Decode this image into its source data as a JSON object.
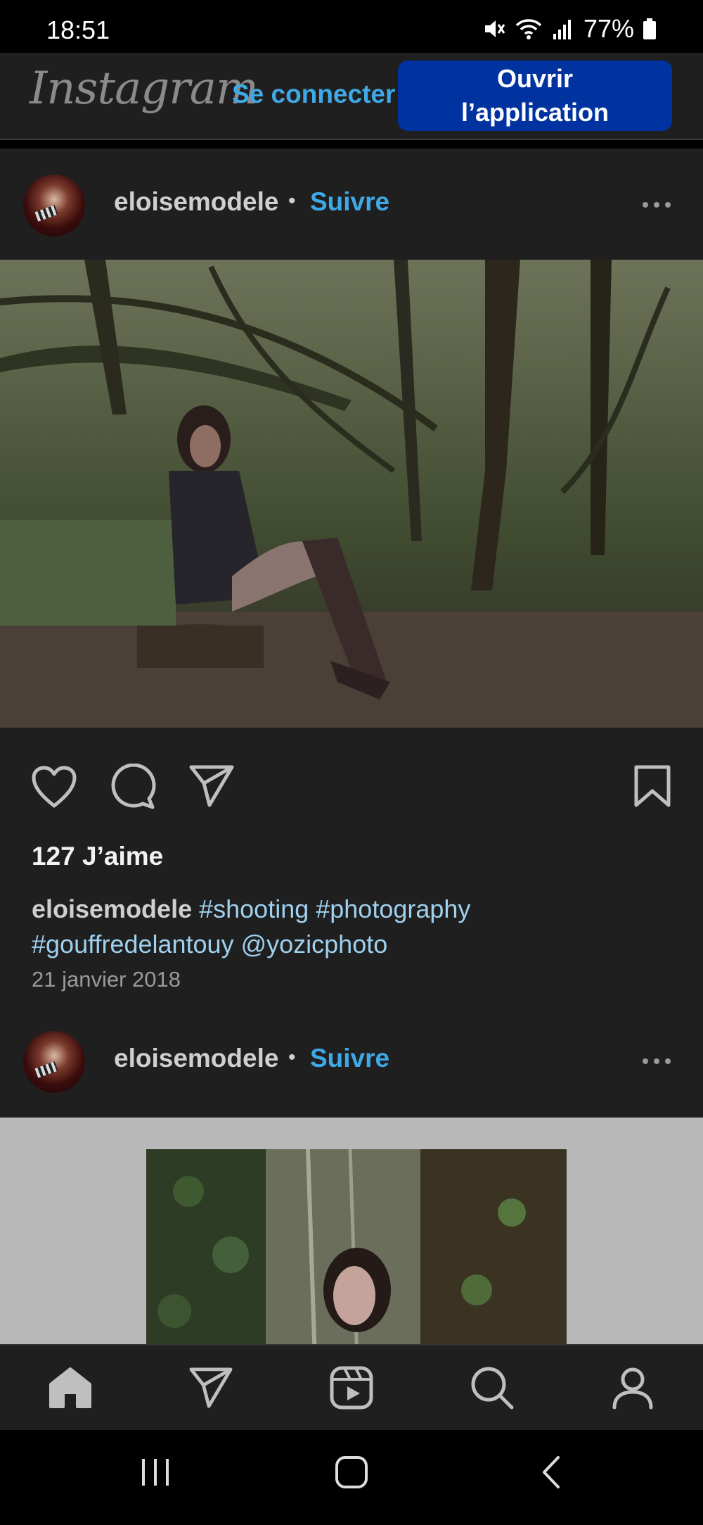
{
  "status_bar": {
    "time": "18:51",
    "battery": "77%"
  },
  "header": {
    "logo": "Instagram",
    "login_label": "Se connecter",
    "open_app_line1": "Ouvrir",
    "open_app_line2": "l’application"
  },
  "post": {
    "username": "eloisemodele",
    "separator": "•",
    "follow_label": "Suivre",
    "likes": "127 J’aime",
    "caption_user": "eloisemodele",
    "caption_text": "#shooting #photography #gouffredelantouy @yozicphoto",
    "date": "21 janvier 2018"
  },
  "next_post": {
    "username": "eloisemodele",
    "separator": "•",
    "follow_label": "Suivre"
  },
  "icons": {
    "like": "heart-icon",
    "comment": "comment-icon",
    "share": "paper-plane-icon",
    "save": "bookmark-icon",
    "more": "more-dots-icon",
    "nav_home": "home-icon",
    "nav_direct": "paper-plane-icon",
    "nav_reels": "reels-icon",
    "nav_search": "search-icon",
    "nav_profile": "profile-icon"
  },
  "colors": {
    "background": "#1f1f1f",
    "link_blue": "#3fa9e8",
    "button_blue": "#0033a0",
    "hashtag_blue": "#9fd0ee"
  }
}
